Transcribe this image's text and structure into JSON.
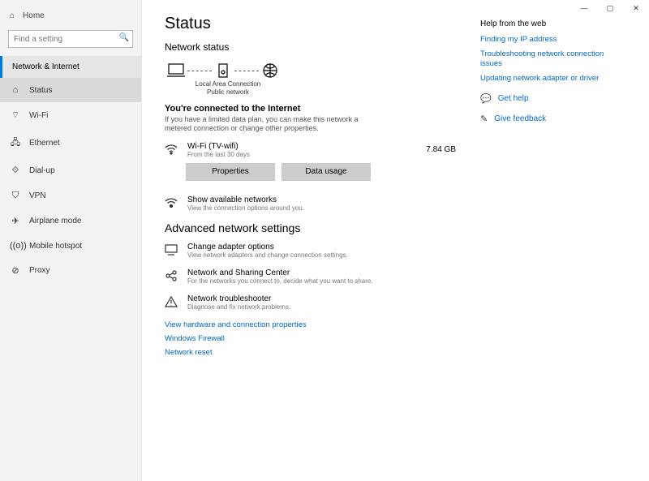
{
  "window": {
    "minimize": "—",
    "maximize": "▢",
    "close": "✕"
  },
  "sidebar": {
    "home": "Home",
    "search_placeholder": "Find a setting",
    "category": "Network & Internet",
    "items": [
      {
        "icon": "⌂",
        "label": "Status"
      },
      {
        "icon": "⌔",
        "label": "Wi-Fi"
      },
      {
        "icon": "🖧",
        "label": "Ethernet"
      },
      {
        "icon": "⟐",
        "label": "Dial-up"
      },
      {
        "icon": "⛉",
        "label": "VPN"
      },
      {
        "icon": "✈",
        "label": "Airplane mode"
      },
      {
        "icon": "((o))",
        "label": "Mobile hotspot"
      },
      {
        "icon": "⊘",
        "label": "Proxy"
      }
    ]
  },
  "main": {
    "title": "Status",
    "subtitle": "Network status",
    "diagram_caption1": "Local Area Connection",
    "diagram_caption2": "Public network",
    "connected_heading": "You're connected to the Internet",
    "connected_info": "If you have a limited data plan, you can make this network a metered connection or change other properties.",
    "connection": {
      "name": "Wi-Fi (TV-wifi)",
      "sub": "From the last 30 days",
      "amount": "7.84 GB"
    },
    "buttons": {
      "properties": "Properties",
      "data_usage": "Data usage"
    },
    "show_networks": {
      "name": "Show available networks",
      "sub": "View the connection options around you."
    },
    "advanced_heading": "Advanced network settings",
    "advanced_items": [
      {
        "name": "Change adapter options",
        "sub": "View network adapters and change connection settings."
      },
      {
        "name": "Network and Sharing Center",
        "sub": "For the networks you connect to, decide what you want to share."
      },
      {
        "name": "Network troubleshooter",
        "sub": "Diagnose and fix network problems."
      }
    ],
    "bottom_links": [
      "View hardware and connection properties",
      "Windows Firewall",
      "Network reset"
    ]
  },
  "right": {
    "help_head": "Help from the web",
    "help_links": [
      "Finding my IP address",
      "Troubleshooting network connection issues",
      "Updating network adapter or driver"
    ],
    "get_help": "Get help",
    "feedback": "Give feedback"
  }
}
